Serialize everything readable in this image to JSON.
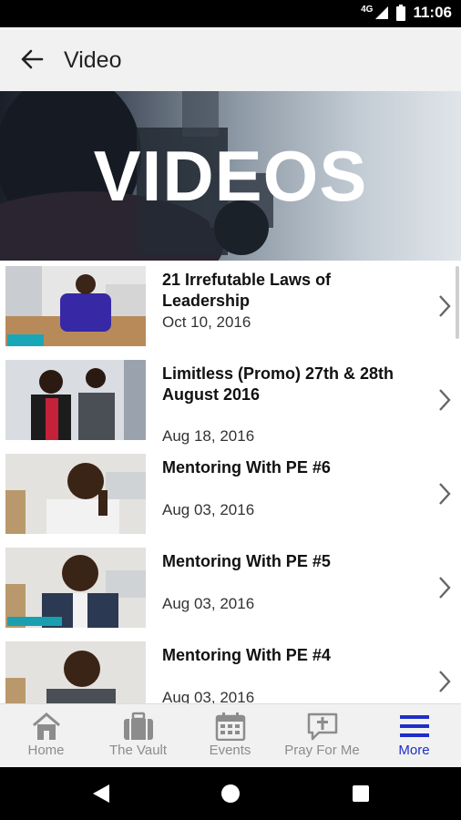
{
  "status_bar": {
    "time": "11:06",
    "network": "4G"
  },
  "app_bar": {
    "title": "Video"
  },
  "hero": {
    "title": "VIDEOS"
  },
  "videos": [
    {
      "title": "21 Irrefutable Laws of Leadership",
      "date": "Oct 10, 2016"
    },
    {
      "title": "Limitless (Promo) 27th & 28th August 2016",
      "date": "Aug 18, 2016"
    },
    {
      "title": "Mentoring With PE #6",
      "date": "Aug 03, 2016"
    },
    {
      "title": "Mentoring With PE #5",
      "date": "Aug 03, 2016"
    },
    {
      "title": "Mentoring With PE #4",
      "date": "Aug 03, 2016"
    }
  ],
  "bottom_nav": {
    "items": [
      {
        "label": "Home",
        "icon": "home-icon"
      },
      {
        "label": "The Vault",
        "icon": "briefcase-icon"
      },
      {
        "label": "Events",
        "icon": "calendar-icon"
      },
      {
        "label": "Pray For Me",
        "icon": "prayer-icon"
      },
      {
        "label": "More",
        "icon": "menu-icon"
      }
    ],
    "active": "More"
  },
  "colors": {
    "accent": "#1e2ec9",
    "inactive": "#8c8c8c"
  }
}
